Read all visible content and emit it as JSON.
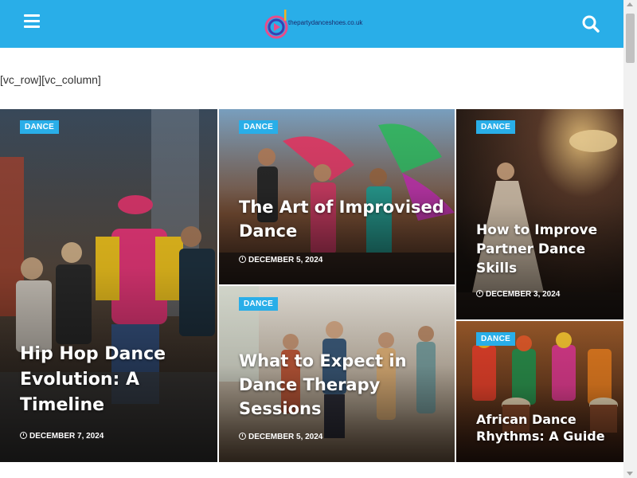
{
  "header": {
    "background": "#29aee8",
    "menu_icon": "hamburger-menu-icon",
    "search_icon": "search-icon",
    "logo_text": "thepartydanceshoes.co.uk"
  },
  "content": {
    "shortcode_text": "[vc_row][vc_column]"
  },
  "posts": [
    {
      "category": "DANCE",
      "title": "Hip Hop Dance Evolution: A Timeline",
      "date": "DECEMBER 7, 2024"
    },
    {
      "category": "DANCE",
      "title": "The Art of Improvised Dance",
      "date": "DECEMBER 5, 2024"
    },
    {
      "category": "DANCE",
      "title": "How to Improve Partner Dance Skills",
      "date": "DECEMBER 3, 2024"
    },
    {
      "category": "DANCE",
      "title": "What to Expect in Dance Therapy Sessions",
      "date": "DECEMBER 5, 2024"
    },
    {
      "category": "DANCE",
      "title": "African Dance Rhythms: A Guide",
      "date": ""
    }
  ],
  "colors": {
    "accent": "#29aee8",
    "badge_text": "#ffffff"
  }
}
